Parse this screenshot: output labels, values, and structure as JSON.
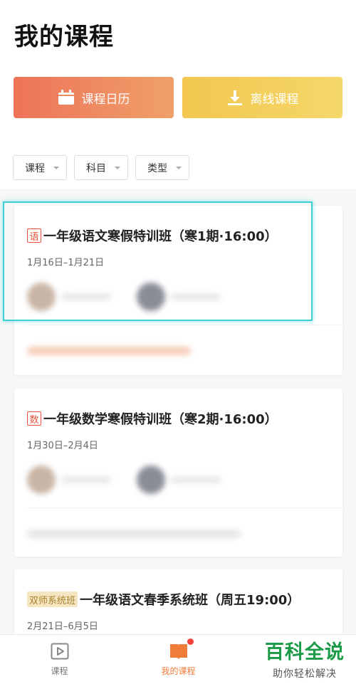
{
  "header": {
    "title": "我的课程"
  },
  "actions": {
    "calendar_label": "课程日历",
    "offline_label": "离线课程"
  },
  "filters": [
    {
      "label": "课程"
    },
    {
      "label": "科目"
    },
    {
      "label": "类型"
    }
  ],
  "courses": [
    {
      "tag": "语",
      "title": "一年级语文寒假特训班（寒1期·16:00）",
      "date": "1月16日–1月21日"
    },
    {
      "tag": "数",
      "title": "一年级数学寒假特训班（寒2期·16:00）",
      "date": "1月30日–2月4日"
    },
    {
      "tag": "双师系统班",
      "title": "一年级语文春季系统班（周五19:00）",
      "date": "2月21日–6月5日"
    }
  ],
  "tabbar": {
    "items": [
      {
        "label": "课程",
        "icon": "video-play-icon"
      },
      {
        "label": "我的课程",
        "icon": "book-icon",
        "active": true,
        "badge_dot": true
      }
    ]
  },
  "watermark": {
    "main": "百科全说",
    "sub": "助你轻松解决"
  },
  "colors": {
    "calendar_button": "#ee7358",
    "offline_button": "#f2c64f",
    "subject_tag": "#e6533a",
    "active_tab": "#f07c3a",
    "highlight_box": "#3fd0d6",
    "watermark": "#1b9b47"
  }
}
